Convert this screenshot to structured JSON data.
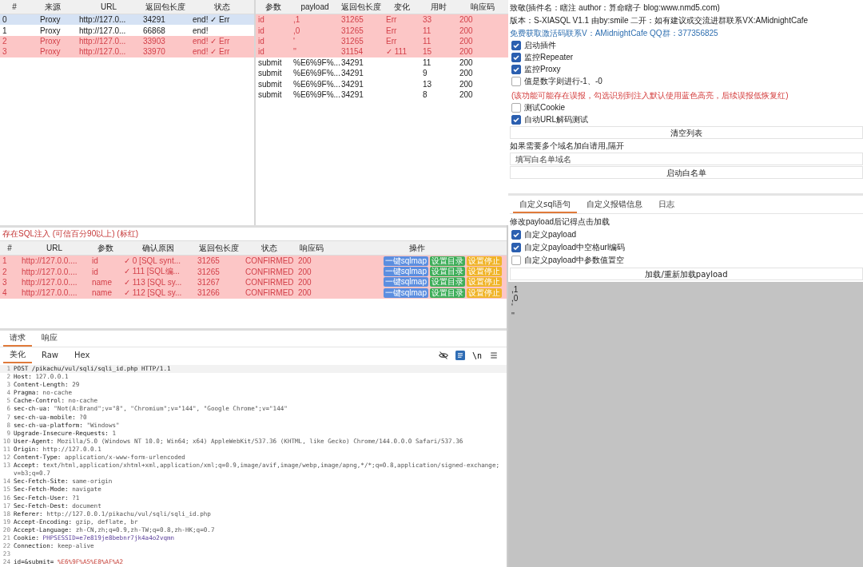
{
  "results_table": {
    "columns": [
      "#",
      "来源",
      "URL",
      "返回包长度",
      "状态"
    ],
    "rows": [
      {
        "cells": [
          "0",
          "Proxy",
          "http://127.0...",
          "34291",
          "end! ✓ Err"
        ],
        "selected": true,
        "flagged": false
      },
      {
        "cells": [
          "1",
          "Proxy",
          "http://127.0...",
          "66868",
          "end!"
        ],
        "selected": false,
        "flagged": false
      },
      {
        "cells": [
          "2",
          "Proxy",
          "http://127.0...",
          "33903",
          "end! ✓ Err"
        ],
        "selected": false,
        "flagged": true
      },
      {
        "cells": [
          "3",
          "Proxy",
          "http://127.0...",
          "33970",
          "end! ✓ Err"
        ],
        "selected": false,
        "flagged": true
      }
    ]
  },
  "payload_table": {
    "columns": [
      "参数",
      "payload",
      "返回包长度",
      "变化",
      "用时",
      "响应码"
    ],
    "rows": [
      {
        "cells": [
          "id",
          ",1",
          "31265",
          "Err",
          "33",
          "200"
        ],
        "flagged": true
      },
      {
        "cells": [
          "id",
          ",0",
          "31265",
          "Err",
          "11",
          "200"
        ],
        "flagged": true
      },
      {
        "cells": [
          "id",
          "'",
          "31265",
          "Err",
          "11",
          "200"
        ],
        "flagged": true
      },
      {
        "cells": [
          "id",
          "''",
          "31154",
          "✓ 111",
          "15",
          "200"
        ],
        "flagged": true
      },
      {
        "cells": [
          "submit",
          "%E6%9F%...",
          "34291",
          "",
          "11",
          "200"
        ],
        "flagged": false
      },
      {
        "cells": [
          "submit",
          "%E6%9F%...",
          "34291",
          "",
          "9",
          "200"
        ],
        "flagged": false
      },
      {
        "cells": [
          "submit",
          "%E6%9F%...",
          "34291",
          "",
          "13",
          "200"
        ],
        "flagged": false
      },
      {
        "cells": [
          "submit",
          "%E6%9F%...",
          "34291",
          "",
          "8",
          "200"
        ],
        "flagged": false
      }
    ]
  },
  "injections": {
    "title": "存在SQL注入 (可信百分90以上) (标红)",
    "columns": [
      "#",
      "URL",
      "参数",
      "确认原因",
      "返回包长度",
      "状态",
      "响应码",
      "操作"
    ],
    "rows": [
      {
        "cells": [
          "1",
          "http://127.0.0....",
          "id",
          "✓ 0 [SQL synt...",
          "31265",
          "CONFIRMED",
          "200"
        ],
        "flagged": true,
        "actions": [
          {
            "label": "一键sqlmap",
            "color": "#5b8ee0"
          },
          {
            "label": "设置目录",
            "color": "#3fae5a"
          },
          {
            "label": "设置停止",
            "color": "#f0b429"
          }
        ]
      },
      {
        "cells": [
          "2",
          "http://127.0.0....",
          "id",
          "✓ 111 [SQL编...",
          "31265",
          "CONFIRMED",
          "200"
        ],
        "flagged": true,
        "actions": [
          {
            "label": "一键sqlmap",
            "color": "#5b8ee0"
          },
          {
            "label": "设置目录",
            "color": "#3fae5a"
          },
          {
            "label": "设置停止",
            "color": "#f0b429"
          }
        ]
      },
      {
        "cells": [
          "3",
          "http://127.0.0....",
          "name",
          "✓ 113 [SQL sy...",
          "31267",
          "CONFIRMED",
          "200"
        ],
        "flagged": true,
        "actions": [
          {
            "label": "一键sqlmap",
            "color": "#5b8ee0"
          },
          {
            "label": "设置目录",
            "color": "#3fae5a"
          },
          {
            "label": "设置停止",
            "color": "#f0b429"
          }
        ]
      },
      {
        "cells": [
          "4",
          "http://127.0.0....",
          "name",
          "✓ 112 [SQL sy...",
          "31266",
          "CONFIRMED",
          "200"
        ],
        "flagged": true,
        "actions": [
          {
            "label": "一键sqlmap",
            "color": "#5b8ee0"
          },
          {
            "label": "设置目录",
            "color": "#3fae5a"
          },
          {
            "label": "设置停止",
            "color": "#f0b429"
          }
        ]
      }
    ]
  },
  "request_tabs": [
    {
      "label": "请求",
      "selected": true
    },
    {
      "label": "响应",
      "selected": false
    }
  ],
  "view_tabs": [
    {
      "label": "美化",
      "selected": true
    },
    {
      "label": "Raw",
      "selected": false
    },
    {
      "label": "Hex",
      "selected": false
    }
  ],
  "editor_toolbar": {
    "wrap_label": "\\n"
  },
  "request_lines": [
    {
      "number": "1",
      "name": "POST /pikachu/vul/sqli/sqli_id.php HTTP/1.1",
      "kind": "header"
    },
    {
      "number": "2",
      "name": "Host:",
      "value": "127.0.0.1",
      "kind": "header"
    },
    {
      "number": "3",
      "name": "Content-Length:",
      "value": "29",
      "kind": "header"
    },
    {
      "number": "4",
      "name": "Pragma:",
      "value": "no-cache",
      "kind": "header"
    },
    {
      "number": "5",
      "name": "Cache-Control:",
      "value": "no-cache",
      "kind": "header"
    },
    {
      "number": "6",
      "name": "sec-ch-ua:",
      "value": "\"Not(A:Brand\";v=\"8\", \"Chromium\";v=\"144\", \"Google Chrome\";v=\"144\"",
      "kind": "header"
    },
    {
      "number": "7",
      "name": "sec-ch-ua-mobile:",
      "value": "?0",
      "kind": "header"
    },
    {
      "number": "8",
      "name": "sec-ch-ua-platform:",
      "value": "\"Windows\"",
      "kind": "header"
    },
    {
      "number": "9",
      "name": "Upgrade-Insecure-Requests:",
      "value": "1",
      "kind": "header"
    },
    {
      "number": "10",
      "name": "User-Agent:",
      "value": "Mozilla/5.0 (Windows NT 10.0; Win64; x64) AppleWebKit/537.36 (KHTML, like Gecko) Chrome/144.0.0.0 Safari/537.36",
      "kind": "header"
    },
    {
      "number": "11",
      "name": "Origin:",
      "value": "http://127.0.0.1",
      "kind": "header"
    },
    {
      "number": "12",
      "name": "Content-Type:",
      "value": "application/x-www-form-urlencoded",
      "kind": "header"
    },
    {
      "number": "13",
      "name": "Accept:",
      "value": "text/html,application/xhtml+xml,application/xml;q=0.9,image/avif,image/webp,image/apng,*/*;q=0.8,application/signed-exchange;v=b3;q=0.7",
      "kind": "header"
    },
    {
      "number": "14",
      "name": "Sec-Fetch-Site:",
      "value": "same-origin",
      "kind": "header"
    },
    {
      "number": "15",
      "name": "Sec-Fetch-Mode:",
      "value": "navigate",
      "kind": "header"
    },
    {
      "number": "16",
      "name": "Sec-Fetch-User:",
      "value": "?1",
      "kind": "header"
    },
    {
      "number": "17",
      "name": "Sec-Fetch-Dest:",
      "value": "document",
      "kind": "header"
    },
    {
      "number": "18",
      "name": "Referer:",
      "value": "http://127.0.0.1/pikachu/vul/sqli/sqli_id.php",
      "kind": "header"
    },
    {
      "number": "19",
      "name": "Accept-Encoding:",
      "value": "gzip, deflate, br",
      "kind": "header"
    },
    {
      "number": "20",
      "name": "Accept-Language:",
      "value": "zh-CN,zh;q=0.9,zh-TW;q=0.8,zh-HK;q=0.7",
      "kind": "header"
    },
    {
      "number": "21",
      "name": "Cookie:",
      "value": "PHPSESSID=e7e819je8bebnr7jk4a4o2vqmn",
      "kind": "cookie"
    },
    {
      "number": "22",
      "name": "Connection:",
      "value": "keep-alive",
      "kind": "header"
    },
    {
      "number": "23"
    },
    {
      "number": "24",
      "name": "id=&submit=",
      "value": "%E6%9F%A5%E8%AF%A2",
      "kind": "param"
    }
  ],
  "info_lines": [
    {
      "text": "致敬(插件名：瞎注 author：算命瞎子 blog:www.nmd5.com)",
      "kind": "plain"
    },
    {
      "text": "版本：S-XIASQL V1.1 由by:smile 二开：如有建议或交流进群联系VX:AMidnightCafe",
      "kind": "plain"
    },
    {
      "text": "免费获取激活码联系V：AMidnightCafe   QQ群：377356825",
      "kind": "link"
    }
  ],
  "options": [
    {
      "label": "启动插件",
      "checked": true
    },
    {
      "label": "监控Repeater",
      "checked": true
    },
    {
      "label": "监控Proxy",
      "checked": true
    },
    {
      "label": "值是数字则进行-1、-0",
      "note": "(该功能可能存在误报，勾选识别到注入默认使用蓝色高亮，后续误报低恢复红)",
      "checked": false
    },
    {
      "label": "测试Cookie",
      "checked": false
    },
    {
      "label": "自动URL解码测试",
      "checked": true
    }
  ],
  "clear_button": "清空列表",
  "whitelist_hint": "如果需要多个域名加白请用,隔开",
  "whitelist_field": {
    "placeholder": "填写白名单域名"
  },
  "whitelist_button": "启动白名单",
  "config_tabs": [
    {
      "label": "自定义sql语句",
      "selected": true
    },
    {
      "label": "自定义报错信息",
      "selected": false
    },
    {
      "label": "日志",
      "selected": false
    }
  ],
  "config_hint": "修改payload后记得点击加载",
  "config_options": [
    {
      "label": "自定义payload",
      "checked": true
    },
    {
      "label": "自定义payload中空格url编码",
      "checked": true
    },
    {
      "label": "自定义payload中参数值置空",
      "checked": false
    }
  ],
  "load_button": "加载/重新加载payload",
  "payload_list": [
    ",1",
    ",0",
    "'",
    "''"
  ]
}
